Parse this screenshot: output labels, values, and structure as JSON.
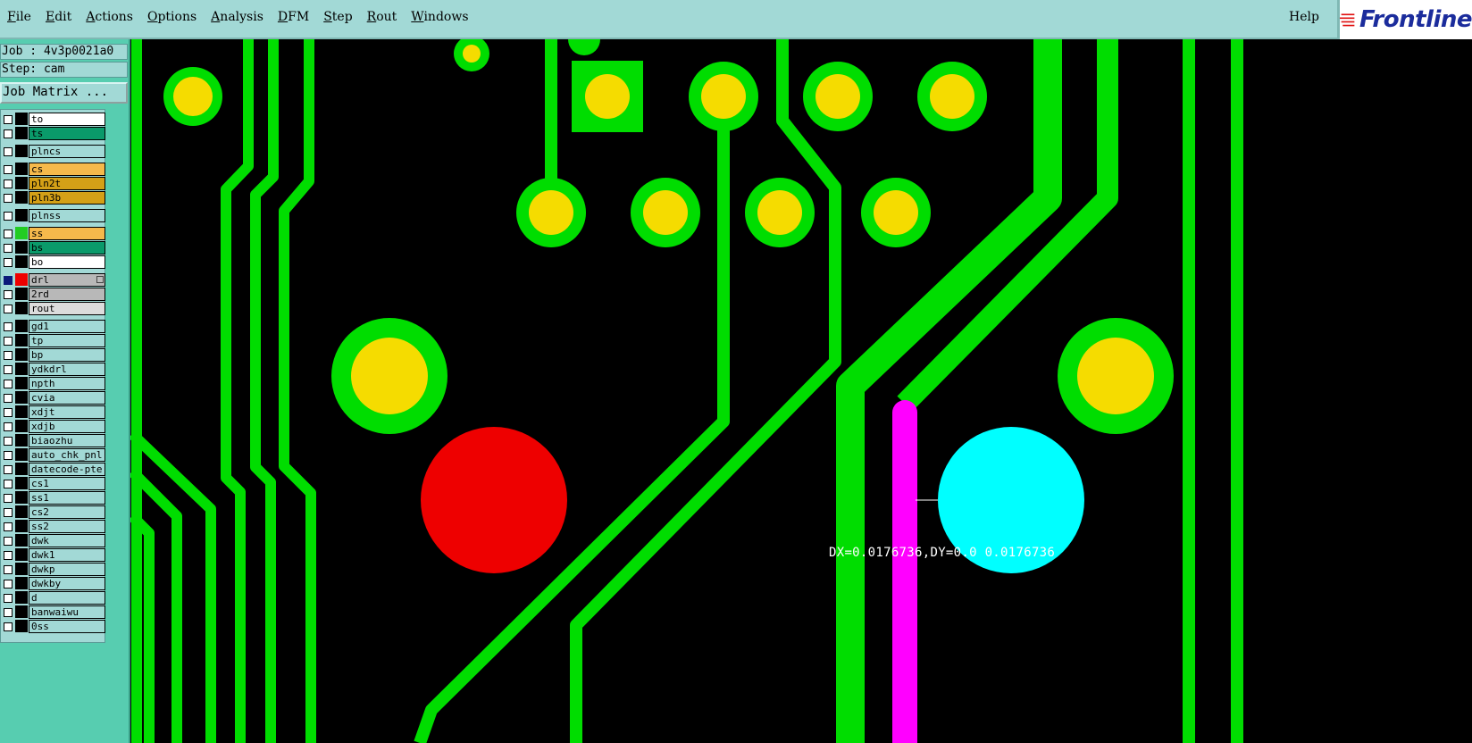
{
  "menubar": {
    "items": [
      {
        "mnemonic": "F",
        "rest": "ile"
      },
      {
        "mnemonic": "E",
        "rest": "dit"
      },
      {
        "mnemonic": "A",
        "rest": "ctions"
      },
      {
        "mnemonic": "O",
        "rest": "ptions"
      },
      {
        "mnemonic": "A",
        "rest": "nalysis"
      },
      {
        "mnemonic": "D",
        "rest": "FM"
      },
      {
        "mnemonic": "S",
        "rest": "tep"
      },
      {
        "mnemonic": "R",
        "rest": "out"
      },
      {
        "mnemonic": "W",
        "rest": "indows"
      }
    ],
    "help_label": "Help",
    "logo_text": "Frontline"
  },
  "side": {
    "job_label": "Job : 4v3p0021a0",
    "step_label": "Step: cam",
    "job_matrix_label": "Job Matrix ..."
  },
  "layers": [
    {
      "name": "to",
      "color": "#ffffff",
      "swatch": "#000000",
      "checked": false
    },
    {
      "name": "ts",
      "color": "#0a9a6a",
      "swatch": "#000000",
      "checked": false
    },
    {
      "name": "plncs",
      "color": "#a2d9d6",
      "swatch": "#000000",
      "checked": false
    },
    {
      "name": "cs",
      "color": "#f5b94b",
      "swatch": "#000000",
      "checked": false
    },
    {
      "name": "pln2t",
      "color": "#d4a017",
      "swatch": "#000000",
      "checked": false
    },
    {
      "name": "pln3b",
      "color": "#d4a017",
      "swatch": "#000000",
      "checked": false
    },
    {
      "name": "plnss",
      "color": "#a2d9d6",
      "swatch": "#000000",
      "checked": false
    },
    {
      "name": "ss",
      "color": "#f5b94b",
      "swatch": "#22cc22",
      "checked": false
    },
    {
      "name": "bs",
      "color": "#0a9a6a",
      "swatch": "#000000",
      "checked": false
    },
    {
      "name": "bo",
      "color": "#ffffff",
      "swatch": "#000000",
      "checked": false
    },
    {
      "name": "drl",
      "color": "#b8b8b8",
      "swatch": "#ee0000",
      "checked": true
    },
    {
      "name": "2rd",
      "color": "#b8b8b8",
      "swatch": "#000000",
      "checked": false
    },
    {
      "name": "rout",
      "color": "#dcdcdc",
      "swatch": "#000000",
      "checked": false
    },
    {
      "name": "gd1",
      "color": "#a2d9d6",
      "swatch": "#000000",
      "checked": false
    },
    {
      "name": "tp",
      "color": "#a2d9d6",
      "swatch": "#000000",
      "checked": false
    },
    {
      "name": "bp",
      "color": "#a2d9d6",
      "swatch": "#000000",
      "checked": false
    },
    {
      "name": "ydkdrl",
      "color": "#a2d9d6",
      "swatch": "#000000",
      "checked": false
    },
    {
      "name": "npth",
      "color": "#a2d9d6",
      "swatch": "#000000",
      "checked": false
    },
    {
      "name": "cvia",
      "color": "#a2d9d6",
      "swatch": "#000000",
      "checked": false
    },
    {
      "name": "xdjt",
      "color": "#a2d9d6",
      "swatch": "#000000",
      "checked": false
    },
    {
      "name": "xdjb",
      "color": "#a2d9d6",
      "swatch": "#000000",
      "checked": false
    },
    {
      "name": "biaozhu",
      "color": "#a2d9d6",
      "swatch": "#000000",
      "checked": false
    },
    {
      "name": "auto_chk_pnl",
      "color": "#a2d9d6",
      "swatch": "#000000",
      "checked": false
    },
    {
      "name": "datecode-pte",
      "color": "#a2d9d6",
      "swatch": "#000000",
      "checked": false
    },
    {
      "name": "cs1",
      "color": "#a2d9d6",
      "swatch": "#000000",
      "checked": false
    },
    {
      "name": "ss1",
      "color": "#a2d9d6",
      "swatch": "#000000",
      "checked": false
    },
    {
      "name": "cs2",
      "color": "#a2d9d6",
      "swatch": "#000000",
      "checked": false
    },
    {
      "name": "ss2",
      "color": "#a2d9d6",
      "swatch": "#000000",
      "checked": false
    },
    {
      "name": "dwk",
      "color": "#a2d9d6",
      "swatch": "#000000",
      "checked": false
    },
    {
      "name": "dwk1",
      "color": "#a2d9d6",
      "swatch": "#000000",
      "checked": false
    },
    {
      "name": "dwkp",
      "color": "#a2d9d6",
      "swatch": "#000000",
      "checked": false
    },
    {
      "name": "dwkby",
      "color": "#a2d9d6",
      "swatch": "#000000",
      "checked": false
    },
    {
      "name": "d",
      "color": "#a2d9d6",
      "swatch": "#000000",
      "checked": false
    },
    {
      "name": "banwaiwu",
      "color": "#a2d9d6",
      "swatch": "#000000",
      "checked": false
    },
    {
      "name": "0ss",
      "color": "#a2d9d6",
      "swatch": "#000000",
      "checked": false
    }
  ],
  "canvas": {
    "measure_text": "DX=0.0176736,DY=0.0 0.0176736",
    "colors": {
      "background": "#000000",
      "copper": "#00dd00",
      "pad": "#f5dc00",
      "drill_hit": "#ee0000",
      "highlight": "#00ffff",
      "route": "#ff00ff"
    }
  }
}
